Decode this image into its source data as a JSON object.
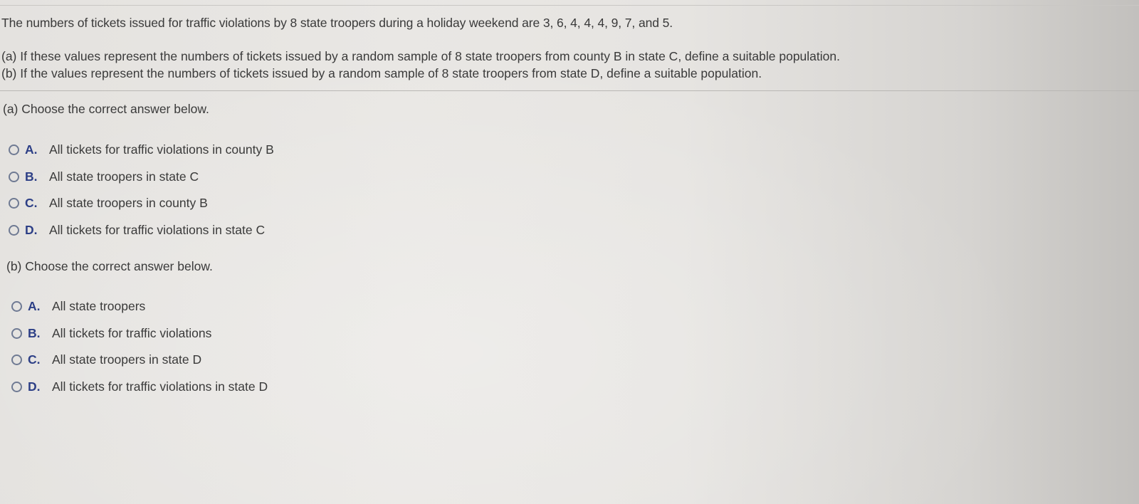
{
  "question": {
    "intro": "The numbers of tickets issued for traffic violations by 8 state troopers during a holiday weekend are 3, 6, 4, 4, 4, 9, 7, and 5.",
    "part_a": "(a) If these values represent the numbers of tickets issued by a random sample of 8 state troopers from county B in state C, define a suitable population.",
    "part_b": "(b) If the values represent the numbers of tickets issued by a random sample of 8 state troopers from state D, define a suitable population."
  },
  "section_a": {
    "prompt": "(a) Choose the correct answer below.",
    "options": [
      {
        "letter": "A.",
        "text": "All tickets for traffic violations in county B"
      },
      {
        "letter": "B.",
        "text": "All state troopers in state C"
      },
      {
        "letter": "C.",
        "text": "All state troopers in county B"
      },
      {
        "letter": "D.",
        "text": "All tickets for traffic violations in state C"
      }
    ]
  },
  "section_b": {
    "prompt": "(b) Choose the correct answer below.",
    "options": [
      {
        "letter": "A.",
        "text": "All state troopers"
      },
      {
        "letter": "B.",
        "text": "All tickets for traffic violations"
      },
      {
        "letter": "C.",
        "text": "All state troopers in state D"
      },
      {
        "letter": "D.",
        "text": "All tickets for traffic violations in state D"
      }
    ]
  },
  "colors": {
    "option_letter": "#2d3f86",
    "radio_border": "#6f7a93",
    "text": "#3a3a3a"
  }
}
